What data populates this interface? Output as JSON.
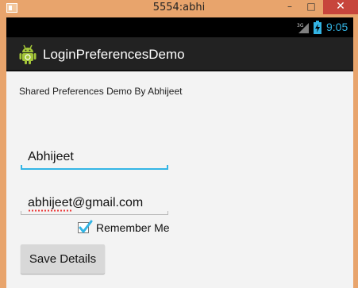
{
  "window": {
    "title": "5554:abhi",
    "minimize": "–",
    "maximize": "□",
    "close": "✕"
  },
  "statusbar": {
    "network": "3G",
    "time": "9:05"
  },
  "actionbar": {
    "title": "LoginPreferencesDemo"
  },
  "main": {
    "heading": "Shared Preferences Demo By Abhijeet",
    "name_value": "Abhijeet",
    "email_value": "abhijeet@gmail.com",
    "remember_label": "Remember Me",
    "remember_checked": true,
    "save_label": "Save Details"
  },
  "colors": {
    "window_frame": "#e8a46c",
    "accent": "#33b5e5",
    "actionbar": "#222222",
    "close_button": "#c7453c"
  }
}
